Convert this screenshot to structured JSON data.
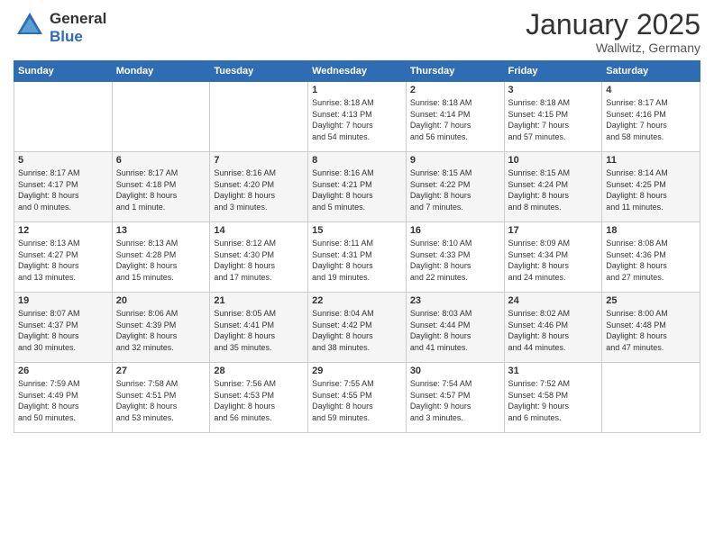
{
  "header": {
    "logo_general": "General",
    "logo_blue": "Blue",
    "month_title": "January 2025",
    "location": "Wallwitz, Germany"
  },
  "weekdays": [
    "Sunday",
    "Monday",
    "Tuesday",
    "Wednesday",
    "Thursday",
    "Friday",
    "Saturday"
  ],
  "weeks": [
    [
      {
        "day": "",
        "info": ""
      },
      {
        "day": "",
        "info": ""
      },
      {
        "day": "",
        "info": ""
      },
      {
        "day": "1",
        "info": "Sunrise: 8:18 AM\nSunset: 4:13 PM\nDaylight: 7 hours\nand 54 minutes."
      },
      {
        "day": "2",
        "info": "Sunrise: 8:18 AM\nSunset: 4:14 PM\nDaylight: 7 hours\nand 56 minutes."
      },
      {
        "day": "3",
        "info": "Sunrise: 8:18 AM\nSunset: 4:15 PM\nDaylight: 7 hours\nand 57 minutes."
      },
      {
        "day": "4",
        "info": "Sunrise: 8:17 AM\nSunset: 4:16 PM\nDaylight: 7 hours\nand 58 minutes."
      }
    ],
    [
      {
        "day": "5",
        "info": "Sunrise: 8:17 AM\nSunset: 4:17 PM\nDaylight: 8 hours\nand 0 minutes."
      },
      {
        "day": "6",
        "info": "Sunrise: 8:17 AM\nSunset: 4:18 PM\nDaylight: 8 hours\nand 1 minute."
      },
      {
        "day": "7",
        "info": "Sunrise: 8:16 AM\nSunset: 4:20 PM\nDaylight: 8 hours\nand 3 minutes."
      },
      {
        "day": "8",
        "info": "Sunrise: 8:16 AM\nSunset: 4:21 PM\nDaylight: 8 hours\nand 5 minutes."
      },
      {
        "day": "9",
        "info": "Sunrise: 8:15 AM\nSunset: 4:22 PM\nDaylight: 8 hours\nand 7 minutes."
      },
      {
        "day": "10",
        "info": "Sunrise: 8:15 AM\nSunset: 4:24 PM\nDaylight: 8 hours\nand 8 minutes."
      },
      {
        "day": "11",
        "info": "Sunrise: 8:14 AM\nSunset: 4:25 PM\nDaylight: 8 hours\nand 11 minutes."
      }
    ],
    [
      {
        "day": "12",
        "info": "Sunrise: 8:13 AM\nSunset: 4:27 PM\nDaylight: 8 hours\nand 13 minutes."
      },
      {
        "day": "13",
        "info": "Sunrise: 8:13 AM\nSunset: 4:28 PM\nDaylight: 8 hours\nand 15 minutes."
      },
      {
        "day": "14",
        "info": "Sunrise: 8:12 AM\nSunset: 4:30 PM\nDaylight: 8 hours\nand 17 minutes."
      },
      {
        "day": "15",
        "info": "Sunrise: 8:11 AM\nSunset: 4:31 PM\nDaylight: 8 hours\nand 19 minutes."
      },
      {
        "day": "16",
        "info": "Sunrise: 8:10 AM\nSunset: 4:33 PM\nDaylight: 8 hours\nand 22 minutes."
      },
      {
        "day": "17",
        "info": "Sunrise: 8:09 AM\nSunset: 4:34 PM\nDaylight: 8 hours\nand 24 minutes."
      },
      {
        "day": "18",
        "info": "Sunrise: 8:08 AM\nSunset: 4:36 PM\nDaylight: 8 hours\nand 27 minutes."
      }
    ],
    [
      {
        "day": "19",
        "info": "Sunrise: 8:07 AM\nSunset: 4:37 PM\nDaylight: 8 hours\nand 30 minutes."
      },
      {
        "day": "20",
        "info": "Sunrise: 8:06 AM\nSunset: 4:39 PM\nDaylight: 8 hours\nand 32 minutes."
      },
      {
        "day": "21",
        "info": "Sunrise: 8:05 AM\nSunset: 4:41 PM\nDaylight: 8 hours\nand 35 minutes."
      },
      {
        "day": "22",
        "info": "Sunrise: 8:04 AM\nSunset: 4:42 PM\nDaylight: 8 hours\nand 38 minutes."
      },
      {
        "day": "23",
        "info": "Sunrise: 8:03 AM\nSunset: 4:44 PM\nDaylight: 8 hours\nand 41 minutes."
      },
      {
        "day": "24",
        "info": "Sunrise: 8:02 AM\nSunset: 4:46 PM\nDaylight: 8 hours\nand 44 minutes."
      },
      {
        "day": "25",
        "info": "Sunrise: 8:00 AM\nSunset: 4:48 PM\nDaylight: 8 hours\nand 47 minutes."
      }
    ],
    [
      {
        "day": "26",
        "info": "Sunrise: 7:59 AM\nSunset: 4:49 PM\nDaylight: 8 hours\nand 50 minutes."
      },
      {
        "day": "27",
        "info": "Sunrise: 7:58 AM\nSunset: 4:51 PM\nDaylight: 8 hours\nand 53 minutes."
      },
      {
        "day": "28",
        "info": "Sunrise: 7:56 AM\nSunset: 4:53 PM\nDaylight: 8 hours\nand 56 minutes."
      },
      {
        "day": "29",
        "info": "Sunrise: 7:55 AM\nSunset: 4:55 PM\nDaylight: 8 hours\nand 59 minutes."
      },
      {
        "day": "30",
        "info": "Sunrise: 7:54 AM\nSunset: 4:57 PM\nDaylight: 9 hours\nand 3 minutes."
      },
      {
        "day": "31",
        "info": "Sunrise: 7:52 AM\nSunset: 4:58 PM\nDaylight: 9 hours\nand 6 minutes."
      },
      {
        "day": "",
        "info": ""
      }
    ]
  ]
}
